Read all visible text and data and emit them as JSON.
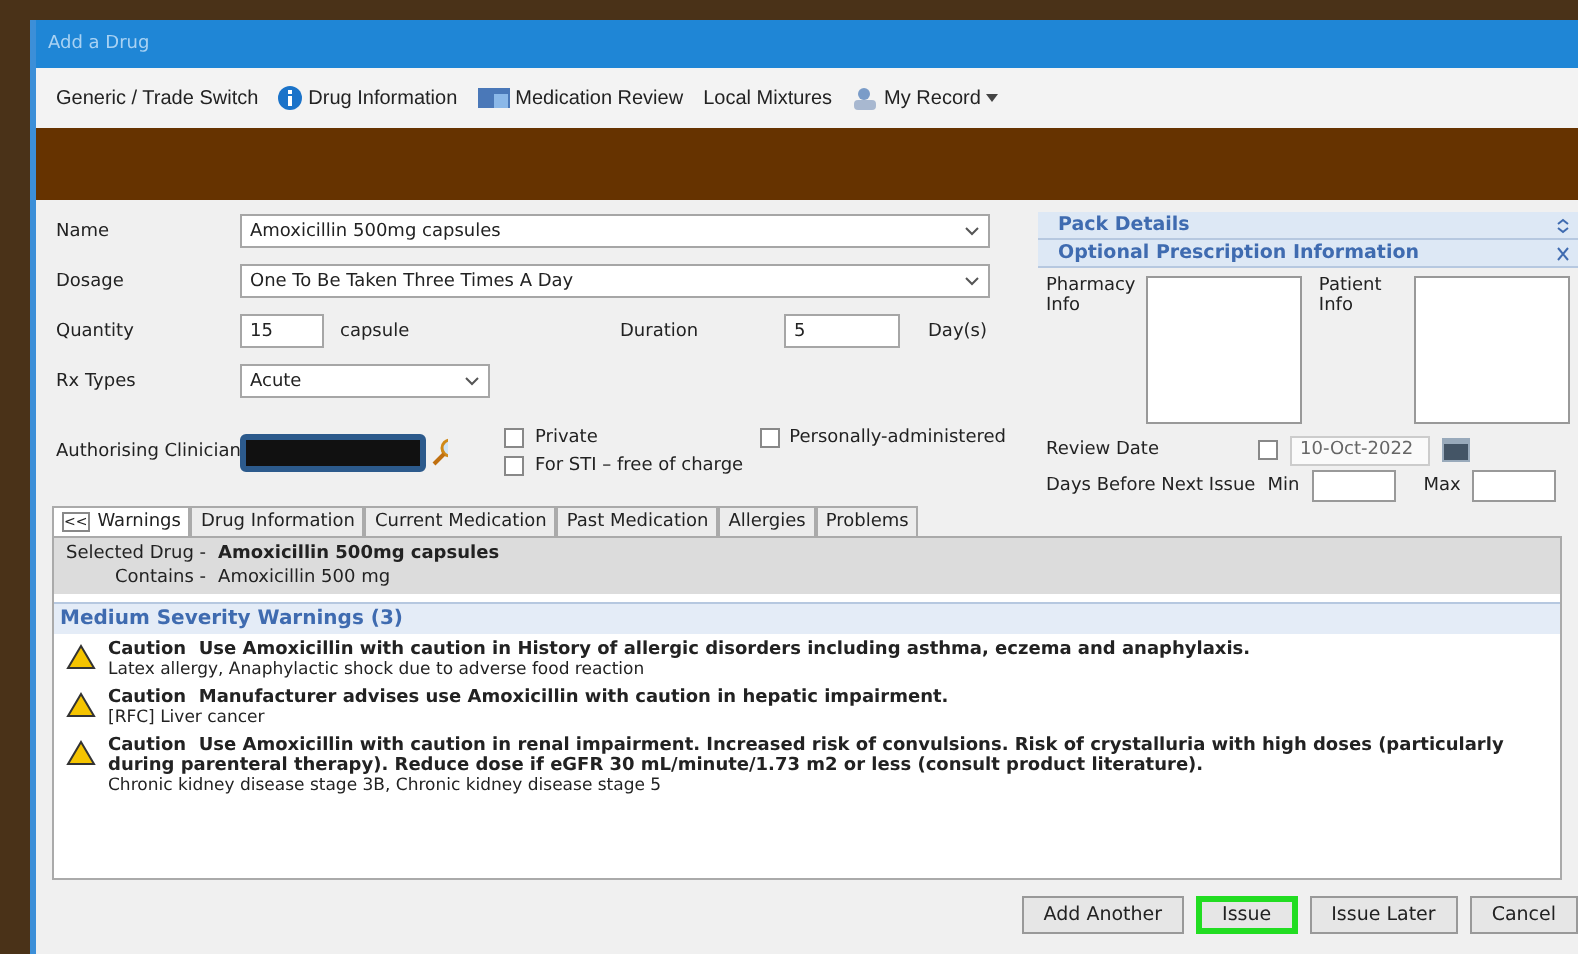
{
  "window": {
    "title": "Add a Drug"
  },
  "toolbar": [
    {
      "label": "Generic / Trade Switch",
      "kind": "text"
    },
    {
      "label": "Drug Information",
      "kind": "info"
    },
    {
      "label": "Medication Review",
      "kind": "review"
    },
    {
      "label": "Local Mixtures",
      "kind": "text"
    },
    {
      "label": "My Record",
      "kind": "record",
      "dropdown": true
    }
  ],
  "form": {
    "name": {
      "label": "Name",
      "value": "Amoxicillin 500mg capsules"
    },
    "dosage": {
      "label": "Dosage",
      "value": "One To Be Taken Three Times A Day"
    },
    "quantity": {
      "label": "Quantity",
      "value": "15",
      "unit": "capsule"
    },
    "duration": {
      "label": "Duration",
      "value": "5",
      "unit": "Day(s)"
    },
    "rx_types": {
      "label": "Rx Types",
      "value": "Acute"
    },
    "clinician": {
      "label": "Authorising Clinician",
      "redacted": true
    },
    "options": [
      {
        "label": "Private",
        "checked": false
      },
      {
        "label": "Personally-administered",
        "checked": false
      },
      {
        "label": "For STI – free of charge",
        "checked": false
      }
    ]
  },
  "side_panel": {
    "pack_details": "Pack Details",
    "optional_title": "Optional Prescription Information",
    "pharmacy_label": "Pharmacy Info",
    "patient_label": "Patient Info",
    "review_date": {
      "label": "Review Date",
      "checked": false,
      "value": "10-Oct-2022"
    },
    "next_issue": {
      "label": "Days Before Next Issue",
      "min_label": "Min",
      "max_label": "Max"
    }
  },
  "tabs": [
    {
      "label": "Warnings",
      "selected": true,
      "collapse": "<<"
    },
    {
      "label": "Drug Information",
      "selected": false
    },
    {
      "label": "Current Medication",
      "selected": false
    },
    {
      "label": "Past Medication",
      "selected": false
    },
    {
      "label": "Allergies",
      "selected": false
    },
    {
      "label": "Problems",
      "selected": false
    }
  ],
  "selected_drug": {
    "label": "Selected Drug -",
    "value": "Amoxicillin 500mg capsules",
    "contains_label": "Contains -",
    "contains": "Amoxicillin 500 mg"
  },
  "warnings_heading": "Medium Severity Warnings (3)",
  "warnings": [
    {
      "level": "Caution",
      "text": "Use Amoxicillin with caution in History of allergic disorders including asthma, eczema and anaphylaxis.",
      "detail": "Latex allergy, Anaphylactic shock due to adverse food reaction"
    },
    {
      "level": "Caution",
      "text": "Manufacturer advises use Amoxicillin with caution in hepatic impairment.",
      "detail": "[RFC] Liver cancer"
    },
    {
      "level": "Caution",
      "text": "Use Amoxicillin with caution in renal impairment. Increased risk of convulsions. Risk of crystalluria with high doses (particularly during parenteral therapy). Reduce dose if eGFR 30 mL/minute/1.73 m2 or less (consult product literature).",
      "detail": "Chronic kidney disease stage 3B, Chronic kidney disease stage 5"
    }
  ],
  "buttons": [
    {
      "label": "Add Another",
      "focused": false
    },
    {
      "label": "Issue",
      "focused": true
    },
    {
      "label": "Issue Later",
      "focused": false
    },
    {
      "label": "Cancel",
      "focused": false
    }
  ]
}
